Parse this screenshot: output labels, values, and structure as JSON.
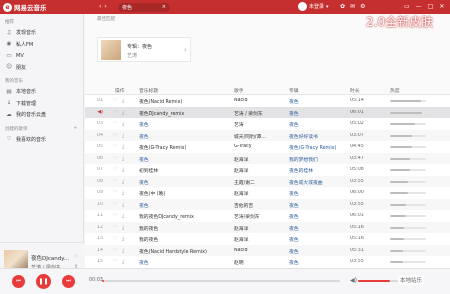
{
  "titlebar": {
    "app_name": "网易云音乐",
    "logo_glyph": "e",
    "back_glyph": "‹",
    "forward_glyph": "›",
    "search_value": "夜色",
    "search_clear": "×",
    "user_label": "未登录",
    "user_dropdown": "▾",
    "icons": [
      "skin-icon",
      "mail-icon",
      "settings-icon"
    ],
    "icon_glyphs": [
      "✿",
      "✉",
      "⚙"
    ],
    "window_controls": [
      "▭",
      "—",
      "□",
      "✕"
    ],
    "accent_color": "#c62f2f"
  },
  "watermark": "2.0全新皮肤",
  "sidebar": {
    "section_recommend": "推荐",
    "recommend_items": [
      {
        "label": "发现音乐",
        "icon": "♫"
      },
      {
        "label": "私人FM",
        "icon": "◉"
      },
      {
        "label": "MV",
        "icon": "▭"
      },
      {
        "label": "朋友",
        "icon": "☺"
      }
    ],
    "section_my_music": "我的音乐",
    "my_music_items": [
      {
        "label": "本地音乐",
        "icon": "▤"
      },
      {
        "label": "下载管理",
        "icon": "↓"
      },
      {
        "label": "我的音乐云盘",
        "icon": "☁"
      }
    ],
    "section_created": "创建的歌单",
    "created_add": "+",
    "created_items": [
      {
        "label": "我喜欢的音乐",
        "icon": "♡"
      }
    ]
  },
  "now_playing": {
    "title": "夜色DJcandy...",
    "artist": "艺涛 / 梁剑东",
    "heart": "♡",
    "share": "⇪"
  },
  "best_match": {
    "heading": "最佳匹配",
    "album_label": "专辑：夜色",
    "artist": "艺涛",
    "chevron": "›"
  },
  "table": {
    "headers": {
      "ops": "操作",
      "title": "音乐标题",
      "artist": "歌手",
      "album": "专辑",
      "duration": "时长",
      "popularity": "热度"
    },
    "heart_glyph": "♡",
    "download_glyph": "⤓",
    "playing_glyph": "◀)",
    "rows": [
      {
        "num": "01",
        "title": "夜色(Nacid Remix)",
        "title_blue": false,
        "artist": "Nacid",
        "album": "夜色",
        "duration": "05:14",
        "pop": 0.85
      },
      {
        "num": "02",
        "title": "夜色DJcandy_remix",
        "title_blue": false,
        "artist": "艺涛 / 梁剑东",
        "album": "夜色",
        "duration": "06:01",
        "pop": 0.9,
        "playing": true
      },
      {
        "num": "03",
        "title": "夜色",
        "title_blue": true,
        "artist": "艺涛",
        "album": "夜色",
        "duration": "05:02",
        "pop": 0.7
      },
      {
        "num": "04",
        "title": "夜色",
        "title_blue": true,
        "artist": "城天/阿豹/谭...",
        "album": "夜色好好读书",
        "duration": "03:07",
        "pop": 0.6
      },
      {
        "num": "05",
        "title": "夜色(G-Tracy Remix)",
        "title_blue": false,
        "artist": "G-Tracy",
        "album": "夜色(G-Tracy Remix)",
        "duration": "04:45",
        "pop": 0.6
      },
      {
        "num": "06",
        "title": "夜色",
        "title_blue": true,
        "artist": "赵海洋",
        "album": "我的梦想我们",
        "duration": "03:47",
        "pop": 0.55
      },
      {
        "num": "07",
        "title": "初到桂林",
        "title_blue": false,
        "artist": "赵海洋",
        "album": "夜色的桂林",
        "duration": "05:08",
        "pop": 0.55
      },
      {
        "num": "08",
        "title": "夜色",
        "title_blue": true,
        "artist": "王霞/谢二",
        "album": "夜色或大或夜曲",
        "duration": "03:55",
        "pop": 0.5
      },
      {
        "num": "09",
        "title": "夜色(中 (晚)",
        "title_blue": false,
        "artist": "赵海洋",
        "album": "夜色",
        "duration": "06:00",
        "pop": 0.5
      },
      {
        "num": "10",
        "title": "夜色",
        "title_blue": true,
        "artist": "吉他的吉",
        "album": "夜色",
        "duration": "03:55",
        "pop": 0.45
      },
      {
        "num": "11",
        "title": "我的夜色DJcandy_remix",
        "title_blue": false,
        "artist": "艺涛/梁剑东",
        "album": "夜色",
        "duration": "06:01",
        "pop": 0.45
      },
      {
        "num": "12",
        "title": "我的夜色",
        "title_blue": false,
        "artist": "赵海洋",
        "album": "夜色",
        "duration": "05:16",
        "pop": 0.4
      },
      {
        "num": "13",
        "title": "我的夜色",
        "title_blue": false,
        "artist": "赵海洋",
        "album": "夜色",
        "duration": "05:16",
        "pop": 0.4
      },
      {
        "num": "14",
        "title": "夜色(Nacid Hardstyle Remix)",
        "title_blue": false,
        "artist": "Nacid",
        "album": "夜色",
        "duration": "05:31",
        "pop": 0.35
      },
      {
        "num": "15",
        "title": "夜色",
        "title_blue": true,
        "artist": "赵明",
        "album": "夜色",
        "duration": "03:55",
        "pop": 0.35
      }
    ]
  },
  "player": {
    "prev_glyph": "⏮",
    "play_glyph": "❚❚",
    "next_glyph": "⏭",
    "current_time": "00:03",
    "progress": 0.01,
    "volume_glyph": "◀)",
    "volume": 0.8,
    "site_mark": "本地站乐"
  }
}
